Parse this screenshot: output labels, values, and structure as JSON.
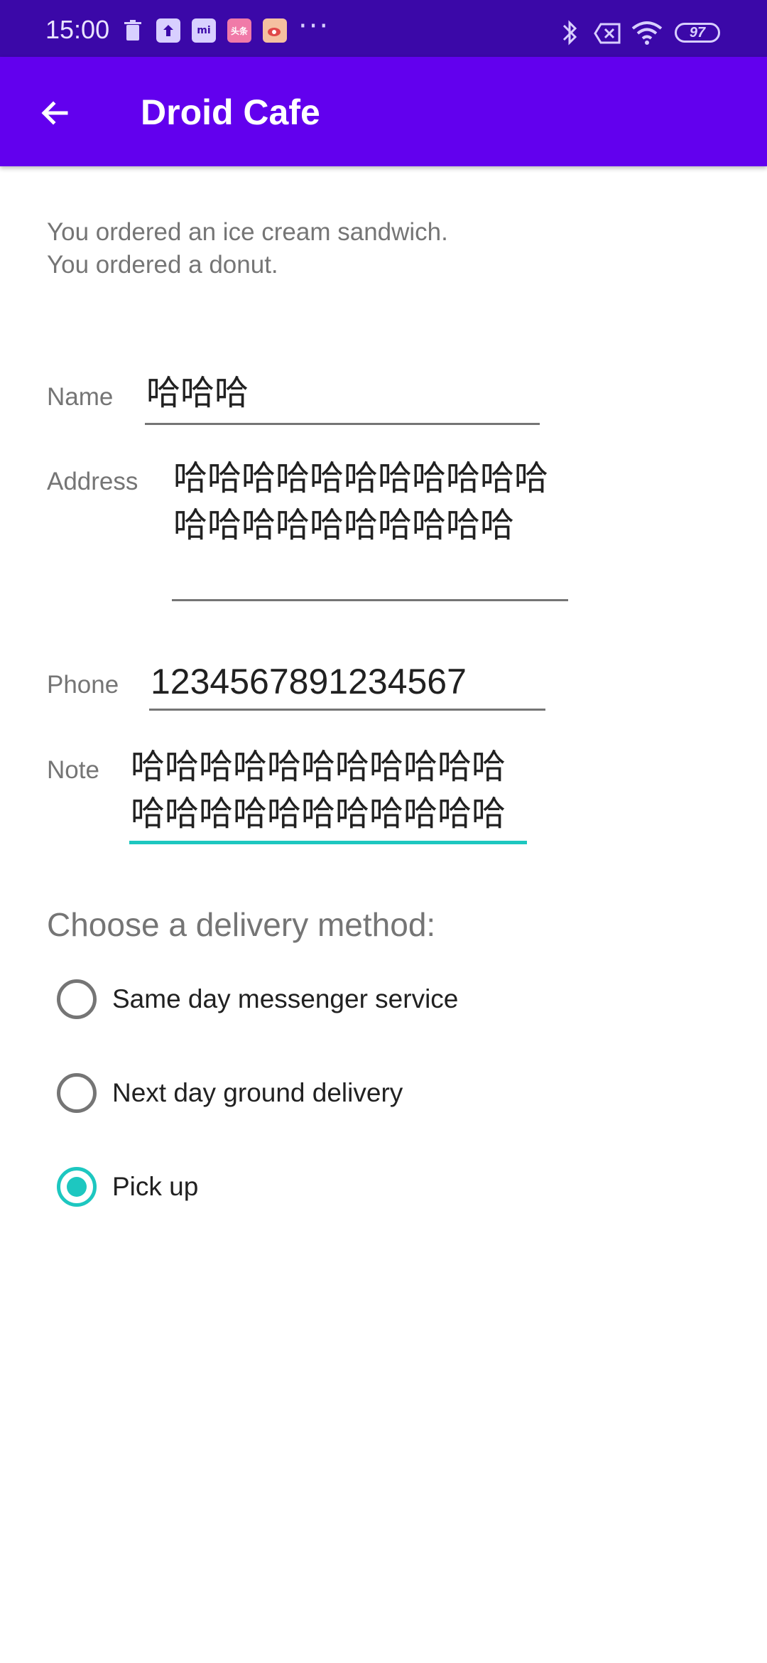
{
  "status_bar": {
    "time": "15:00",
    "notification_icons": [
      "trash-icon",
      "upload-icon",
      "mi-store-icon",
      "toutiao-icon",
      "weibo-icon"
    ],
    "toutiao_label": "头条",
    "mi_label": "mi",
    "overflow": "···",
    "battery_level": "97"
  },
  "app_bar": {
    "title": "Droid Cafe",
    "background": "#6200ee"
  },
  "order": {
    "line1": "You ordered an ice cream sandwich.",
    "line2": "You ordered a donut."
  },
  "form": {
    "name_label": "Name",
    "name_value": "哈哈哈",
    "address_label": "Address",
    "address_value": "哈哈哈哈哈哈哈哈哈哈哈哈哈哈哈哈哈哈哈哈哈",
    "phone_label": "Phone",
    "phone_value": "1234567891234567",
    "note_label": "Note",
    "note_value": "哈哈哈哈哈哈哈哈哈哈哈哈哈哈哈哈哈哈哈哈哈哈"
  },
  "delivery": {
    "heading": "Choose a delivery method:",
    "options": [
      {
        "label": "Same day messenger service",
        "checked": false
      },
      {
        "label": "Next day ground delivery",
        "checked": false
      },
      {
        "label": "Pick up",
        "checked": true
      }
    ]
  },
  "colors": {
    "accent": "#1dc7c0",
    "status_bar": "#3b08a8"
  }
}
